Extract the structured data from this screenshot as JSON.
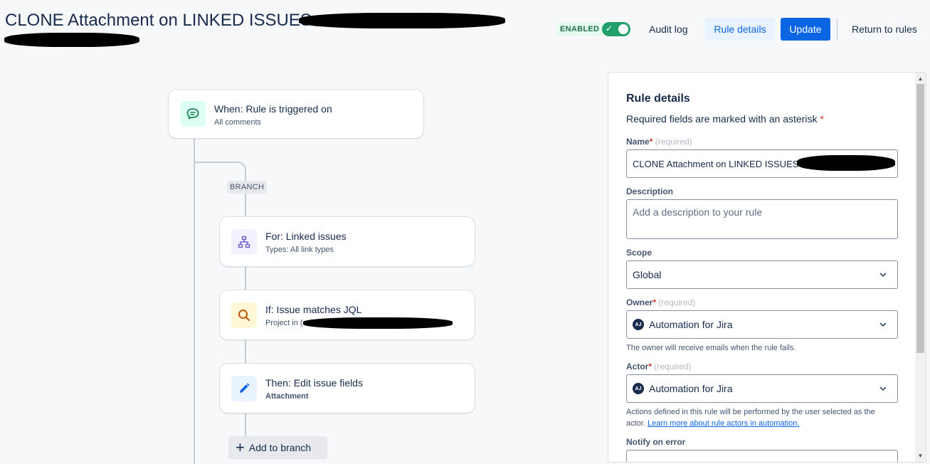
{
  "header": {
    "title": "CLONE Attachment on LINKED ISSUES",
    "status_badge": "ENABLED",
    "audit_log": "Audit log",
    "rule_details": "Rule details",
    "update": "Update",
    "return_to_rules": "Return to rules"
  },
  "flow": {
    "trigger": {
      "title": "When: Rule is triggered on",
      "subtitle": "All comments"
    },
    "branch_tag": "BRANCH",
    "branch_node": {
      "title": "For: Linked issues",
      "subtitle": "Types: All link types"
    },
    "condition": {
      "title": "If: Issue matches JQL",
      "subtitle": "Project in ("
    },
    "action": {
      "title": "Then: Edit issue fields",
      "subtitle": "Attachment"
    },
    "add_branch": "Add to branch"
  },
  "panel": {
    "heading": "Rule details",
    "required_note": "Required fields are marked with an asterisk",
    "asterisk": "*",
    "name_label": "Name",
    "required_hint": "(required)",
    "name_value": "CLONE Attachment on LINKED ISSUES",
    "description_label": "Description",
    "description_placeholder": "Add a description to your rule",
    "scope_label": "Scope",
    "scope_value": "Global",
    "owner_label": "Owner",
    "owner_avatar": "AJ",
    "owner_value": "Automation for Jira",
    "owner_help": "The owner will receive emails when the rule fails.",
    "actor_label": "Actor",
    "actor_avatar": "AJ",
    "actor_value": "Automation for Jira",
    "actor_help": "Actions defined in this rule will be performed by the user selected as the actor.",
    "actor_help_link": "Learn more about rule actors in automation.",
    "notify_label": "Notify on error"
  },
  "colors": {
    "primary": "#0c66e4",
    "enabled_green": "#22a06b",
    "trigger_icon_bg": "#dcfff1",
    "branch_icon_bg": "#f3f0ff",
    "condition_icon_bg": "#fff7d6",
    "action_icon_bg": "#e9f2ff"
  }
}
